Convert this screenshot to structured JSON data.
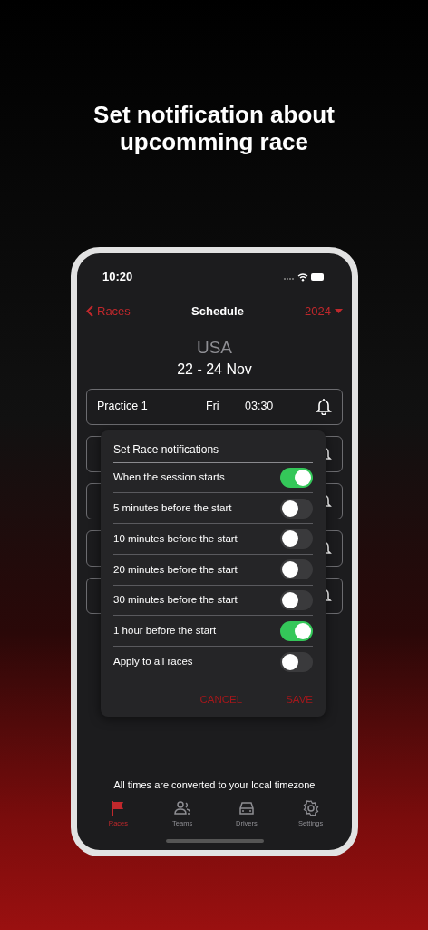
{
  "headline": "Set notification about upcomming race",
  "status_bar": {
    "time": "10:20"
  },
  "nav": {
    "back": "Races",
    "title": "Schedule",
    "year": "2024"
  },
  "event": {
    "country": "USA",
    "dates": "22 - 24 Nov"
  },
  "sessions": [
    {
      "name": "Practice 1",
      "day": "Fri",
      "time": "03:30",
      "notify": true
    },
    {
      "notify": true
    },
    {
      "notify": true
    },
    {
      "notify": true
    },
    {
      "notify": true
    }
  ],
  "dialog": {
    "title": "Set Race notifications",
    "options": [
      {
        "label": "When the session starts",
        "on": true
      },
      {
        "label": "5 minutes before the start",
        "on": false
      },
      {
        "label": "10 minutes before the start",
        "on": false
      },
      {
        "label": "20 minutes before the start",
        "on": false
      },
      {
        "label": "30 minutes before the start",
        "on": false
      },
      {
        "label": "1 hour before the start",
        "on": true
      },
      {
        "label": "Apply to all races",
        "on": false
      }
    ],
    "buttons": [
      "CANCEL",
      "SAVE"
    ]
  },
  "footer_note": "All times are converted to your local timezone",
  "tabs": [
    {
      "label": "Races",
      "kind": "flag",
      "selected": true
    },
    {
      "label": "Teams",
      "kind": "people",
      "selected": false
    },
    {
      "label": "Drivers",
      "kind": "car",
      "selected": false
    },
    {
      "label": "Settings",
      "kind": "gear",
      "selected": false
    }
  ]
}
